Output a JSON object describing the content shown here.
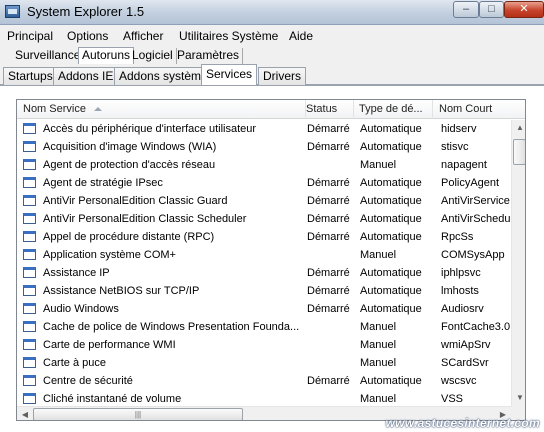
{
  "window": {
    "title": "System Explorer 1.5",
    "buttons": {
      "minimize": "–",
      "maximize": "□",
      "close": "✕"
    }
  },
  "menu": [
    "Principal",
    "Options",
    "Afficher",
    "Utilitaires Système",
    "Aide"
  ],
  "top_tabs": [
    "Surveillance",
    "Autoruns",
    "Logiciel",
    "Paramètres"
  ],
  "top_tabs_active": "Autoruns",
  "inner_tabs": [
    "Startups",
    "Addons IE",
    "Addons système",
    "Services",
    "Drivers"
  ],
  "inner_tabs_active": "Services",
  "table": {
    "columns": [
      "Nom Service",
      "Status",
      "Type de dé...",
      "Nom Court"
    ],
    "sorted_column": "Nom Service",
    "rows": [
      [
        "Accès du périphérique d'interface utilisateur",
        "Démarré",
        "Automatique",
        "hidserv"
      ],
      [
        "Acquisition d'image Windows (WIA)",
        "Démarré",
        "Automatique",
        "stisvc"
      ],
      [
        "Agent de protection d'accès réseau",
        "",
        "Manuel",
        "napagent"
      ],
      [
        "Agent de stratégie IPsec",
        "Démarré",
        "Automatique",
        "PolicyAgent"
      ],
      [
        "AntiVir PersonalEdition Classic Guard",
        "Démarré",
        "Automatique",
        "AntiVirService"
      ],
      [
        "AntiVir PersonalEdition Classic Scheduler",
        "Démarré",
        "Automatique",
        "AntiVirSchedul"
      ],
      [
        "Appel de procédure distante (RPC)",
        "Démarré",
        "Automatique",
        "RpcSs"
      ],
      [
        "Application système COM+",
        "",
        "Manuel",
        "COMSysApp"
      ],
      [
        "Assistance IP",
        "Démarré",
        "Automatique",
        "iphlpsvc"
      ],
      [
        "Assistance NetBIOS sur TCP/IP",
        "Démarré",
        "Automatique",
        "lmhosts"
      ],
      [
        "Audio Windows",
        "Démarré",
        "Automatique",
        "Audiosrv"
      ],
      [
        "Cache de police de Windows Presentation Founda...",
        "",
        "Manuel",
        "FontCache3.0"
      ],
      [
        "Carte de performance WMI",
        "",
        "Manuel",
        "wmiApSrv"
      ],
      [
        "Carte à puce",
        "",
        "Manuel",
        "SCardSvr"
      ],
      [
        "Centre de sécurité",
        "Démarré",
        "Automatique",
        "wscsvc"
      ],
      [
        "Cliché instantané de volume",
        "",
        "Manuel",
        "VSS"
      ]
    ]
  },
  "icons": {
    "app": "app-icon",
    "service": "service-window-icon",
    "scroll_up": "▲",
    "scroll_down": "▼",
    "scroll_left": "◀",
    "scroll_right": "▶",
    "grip": "|||"
  },
  "watermark": "www.astucesinternet.com"
}
